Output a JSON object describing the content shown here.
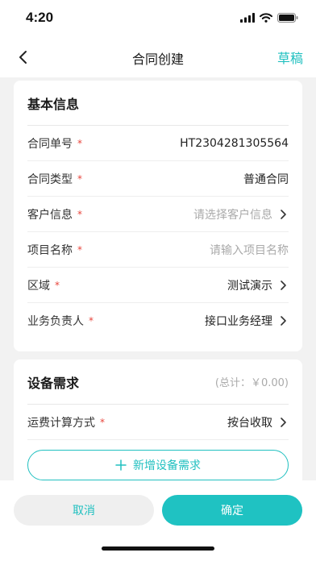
{
  "status_bar": {
    "time": "4:20"
  },
  "nav": {
    "title": "合同创建",
    "action_label": "草稿"
  },
  "basic_info": {
    "title": "基本信息",
    "rows": [
      {
        "label": "合同单号",
        "value": "HT2304281305564"
      },
      {
        "label": "合同类型",
        "value": "普通合同"
      },
      {
        "label": "客户信息",
        "placeholder": "请选择客户信息"
      },
      {
        "label": "项目名称",
        "placeholder": "请输入项目名称"
      },
      {
        "label": "区域",
        "value": "测试演示"
      },
      {
        "label": "业务负责人",
        "value": "接口业务经理"
      }
    ]
  },
  "equipment": {
    "title": "设备需求",
    "total": "(总计：￥0.00)",
    "freight": {
      "label": "运费计算方式",
      "value": "按台收取"
    },
    "add_label": "新增设备需求"
  },
  "required_mark": "*",
  "footer": {
    "cancel_label": "取消",
    "confirm_label": "确定"
  },
  "colors": {
    "accent": "#21c0c0",
    "required": "#e8453c",
    "background": "#f2f2f2"
  },
  "icons": [
    "back-chevron-icon",
    "signal-icon",
    "wifi-icon",
    "battery-icon",
    "chevron-right-icon",
    "plus-icon"
  ]
}
